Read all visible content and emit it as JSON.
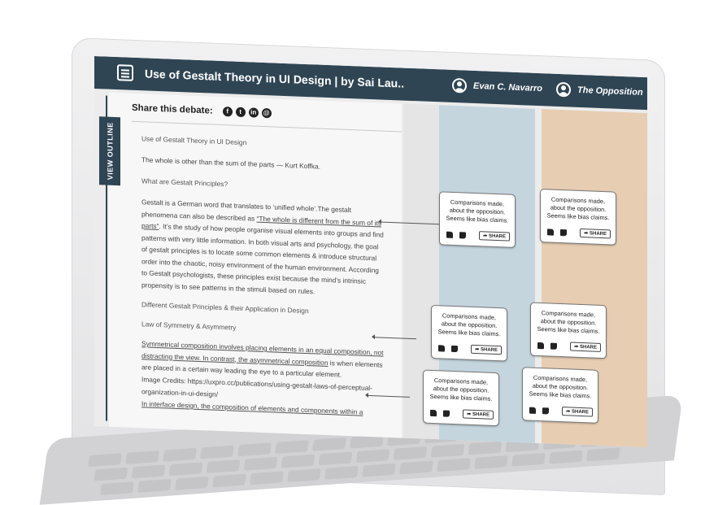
{
  "header": {
    "title": "Use of Gestalt Theory in UI Design | by Sai Lau...",
    "user_a": "Evan C. Navarro",
    "user_b": "The Opposition"
  },
  "sidebar": {
    "outline_label": "VIEW OUTLINE"
  },
  "share": {
    "label": "Share this debate:",
    "icons": [
      "facebook-icon",
      "twitter-icon",
      "linkedin-icon",
      "email-icon"
    ]
  },
  "article": {
    "p1": "Use of Gestalt Theory in UI Design",
    "p2": "The whole is other than the sum of the parts — Kurt Koffka.",
    "p3": "What are Gestalt Principles?",
    "p4a": "Gestalt is a German word that translates to ‘unified whole’.The gestalt phenomena can also be described as ",
    "p4b": "“The whole is different from the sum of its parts”",
    "p4c": ". It’s the study of how people organise visual elements into groups and find patterns with very little information. In both visual arts and psychology, the goal of gestalt principles is to locate some common elements & introduce structural order into the chaotic, noisy environment of the human environment. According to Gestalt psychologists, these principles exist because the mind’s intrinsic propensity is to see patterns in the stimuli based on rules.",
    "p5": "Different Gestalt Principles & their Application in Design",
    "p6": "Law of Symmetry & Asymmetry",
    "p7a": "Symmetrical composition involves placing elements in an equal composition, not distracting the view. In contrast, the asymmetrical composition",
    "p7b": " is when elements are placed in a certain way leading the eye to a particular element.",
    "p8": "Image Credits: https://uxpro.cc/publications/using-gestalt-laws-of-perceptual-organization-in-ui-design/",
    "p9": "In interface design, the composition of elements and components within a"
  },
  "card": {
    "text": "Comparisons made, about the opposition. Seems like bias claims.",
    "share_label": "SHARE"
  },
  "colors": {
    "header": "#2f4554",
    "blue_column": "#c4d5de",
    "tan_column": "#e7cdb2"
  }
}
